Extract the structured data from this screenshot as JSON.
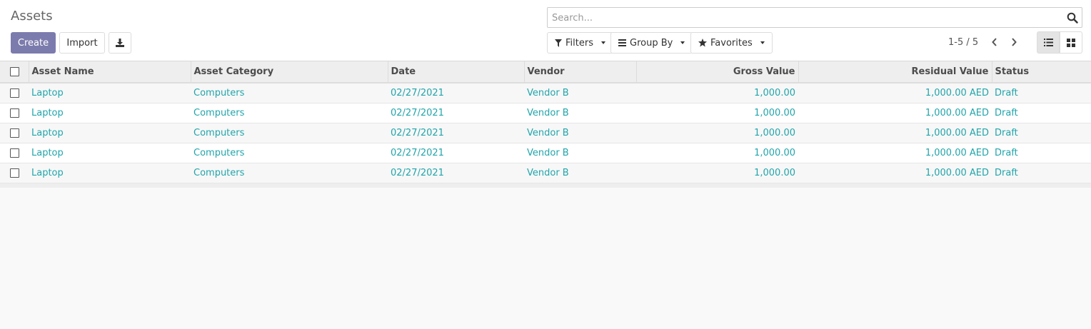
{
  "page": {
    "title": "Assets"
  },
  "toolbar": {
    "create_label": "Create",
    "import_label": "Import"
  },
  "search": {
    "placeholder": "Search..."
  },
  "filters": {
    "filters_label": "Filters",
    "group_by_label": "Group By",
    "favorites_label": "Favorites"
  },
  "pager": {
    "text": "1-5 / 5"
  },
  "colors": {
    "accent": "#7c7bad",
    "link": "#21a5ab"
  },
  "table": {
    "headers": {
      "asset_name": "Asset Name",
      "asset_category": "Asset Category",
      "date": "Date",
      "vendor": "Vendor",
      "gross_value": "Gross Value",
      "residual_value": "Residual Value",
      "status": "Status"
    },
    "rows": [
      {
        "name": "Laptop",
        "category": "Computers",
        "date": "02/27/2021",
        "vendor": "Vendor B",
        "gross": "1,000.00",
        "residual": "1,000.00 AED",
        "status": "Draft"
      },
      {
        "name": "Laptop",
        "category": "Computers",
        "date": "02/27/2021",
        "vendor": "Vendor B",
        "gross": "1,000.00",
        "residual": "1,000.00 AED",
        "status": "Draft"
      },
      {
        "name": "Laptop",
        "category": "Computers",
        "date": "02/27/2021",
        "vendor": "Vendor B",
        "gross": "1,000.00",
        "residual": "1,000.00 AED",
        "status": "Draft"
      },
      {
        "name": "Laptop",
        "category": "Computers",
        "date": "02/27/2021",
        "vendor": "Vendor B",
        "gross": "1,000.00",
        "residual": "1,000.00 AED",
        "status": "Draft"
      },
      {
        "name": "Laptop",
        "category": "Computers",
        "date": "02/27/2021",
        "vendor": "Vendor B",
        "gross": "1,000.00",
        "residual": "1,000.00 AED",
        "status": "Draft"
      }
    ]
  }
}
